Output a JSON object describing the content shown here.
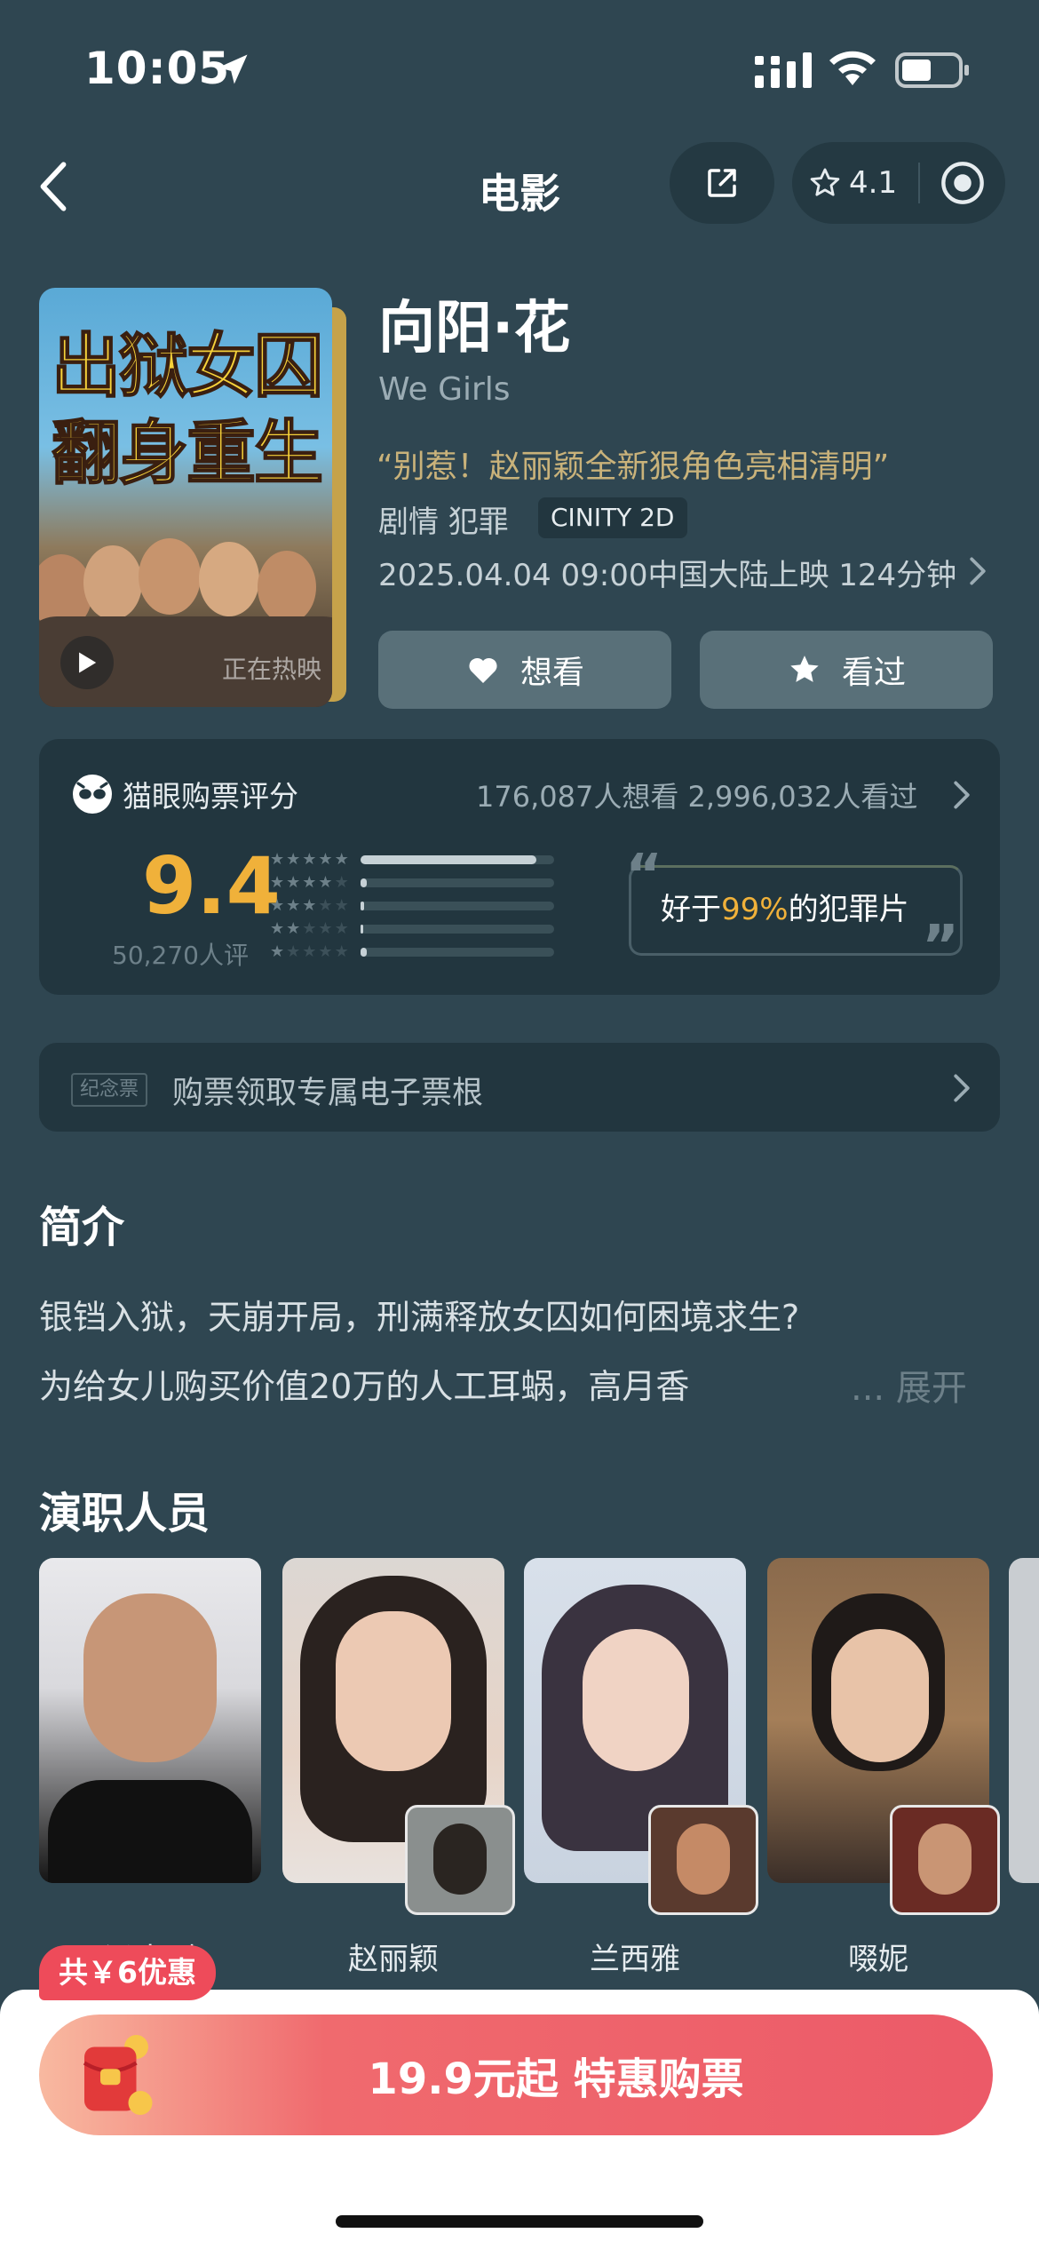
{
  "status_bar": {
    "time": "10:05"
  },
  "nav": {
    "title": "电影",
    "rating": "4.1"
  },
  "movie": {
    "title": "向阳·花",
    "english_title": "We Girls",
    "tagline": "“别惹！赵丽颖全新狠角色亮相清明”",
    "genre": "剧情 犯罪",
    "format": "CINITY 2D",
    "release": "2025.04.04 09:00中国大陆上映 124分钟",
    "poster_text_line1": "出狱女囚",
    "poster_text_line2": "翻身重生",
    "poster_corner": "正在热映"
  },
  "actions": {
    "want": "想看",
    "watched": "看过"
  },
  "score": {
    "label": "猫眼购票评分",
    "counts": "176,087人想看 2,996,032人看过",
    "value": "9.4",
    "people": "50,270人评",
    "distribution": [
      0.91,
      0.03,
      0.02,
      0.01,
      0.03
    ],
    "better_prefix": "好于",
    "better_percent": "99%",
    "better_suffix": "的犯罪片"
  },
  "ticket": {
    "tag": "纪念票",
    "text": "购票领取专属电子票根"
  },
  "synopsis": {
    "title": "简介",
    "line1": "银铛入狱，天崩开局，刑满释放女囚如何困境求生?",
    "line2": "为给女儿购买价值20万的人工耳蜗，高月香",
    "expand": "... 展开"
  },
  "cast": {
    "title": "演职人员",
    "members": [
      {
        "name": "冯小刚"
      },
      {
        "name": "赵丽颖"
      },
      {
        "name": "兰西雅"
      },
      {
        "name": "啜妮"
      }
    ]
  },
  "promo": {
    "discount": "共￥6优惠",
    "buy_label": "19.9元起 特惠购票"
  },
  "colors": {
    "background": "#2f4651",
    "card": "#22363f",
    "accent": "#f0b13a",
    "buy": "#ec5a68"
  }
}
